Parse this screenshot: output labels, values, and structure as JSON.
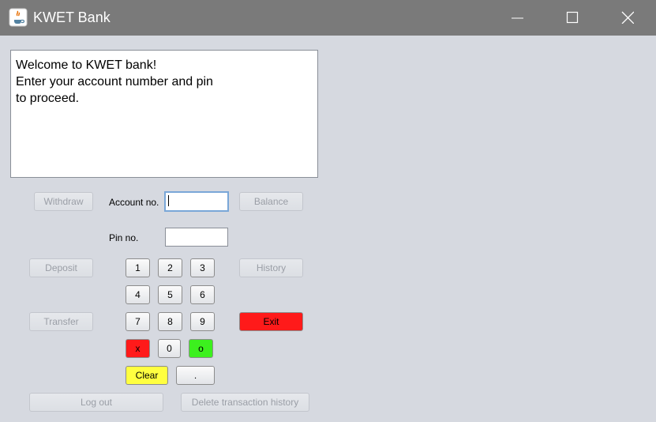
{
  "window": {
    "title": "KWET Bank"
  },
  "display": {
    "lines": [
      "Welcome to KWET bank!",
      "Enter your account number and pin",
      "to proceed."
    ]
  },
  "buttons": {
    "withdraw": "Withdraw",
    "balance": "Balance",
    "deposit": "Deposit",
    "history": "History",
    "transfer": "Transfer",
    "exit": "Exit",
    "logout": "Log out",
    "delete_history": "Delete transaction history"
  },
  "labels": {
    "account": "Account no.",
    "pin": "Pin no."
  },
  "fields": {
    "account_value": "",
    "pin_value": ""
  },
  "keypad": {
    "k1": "1",
    "k2": "2",
    "k3": "3",
    "k4": "4",
    "k5": "5",
    "k6": "6",
    "k7": "7",
    "k8": "8",
    "k9": "9",
    "cancel": "x",
    "k0": "0",
    "ok": "o",
    "clear": "Clear",
    "dot": "."
  },
  "colors": {
    "cancel": "#ff1a1a",
    "ok": "#3cf01e",
    "exit": "#ff1a1a",
    "clear": "#ffff40"
  }
}
